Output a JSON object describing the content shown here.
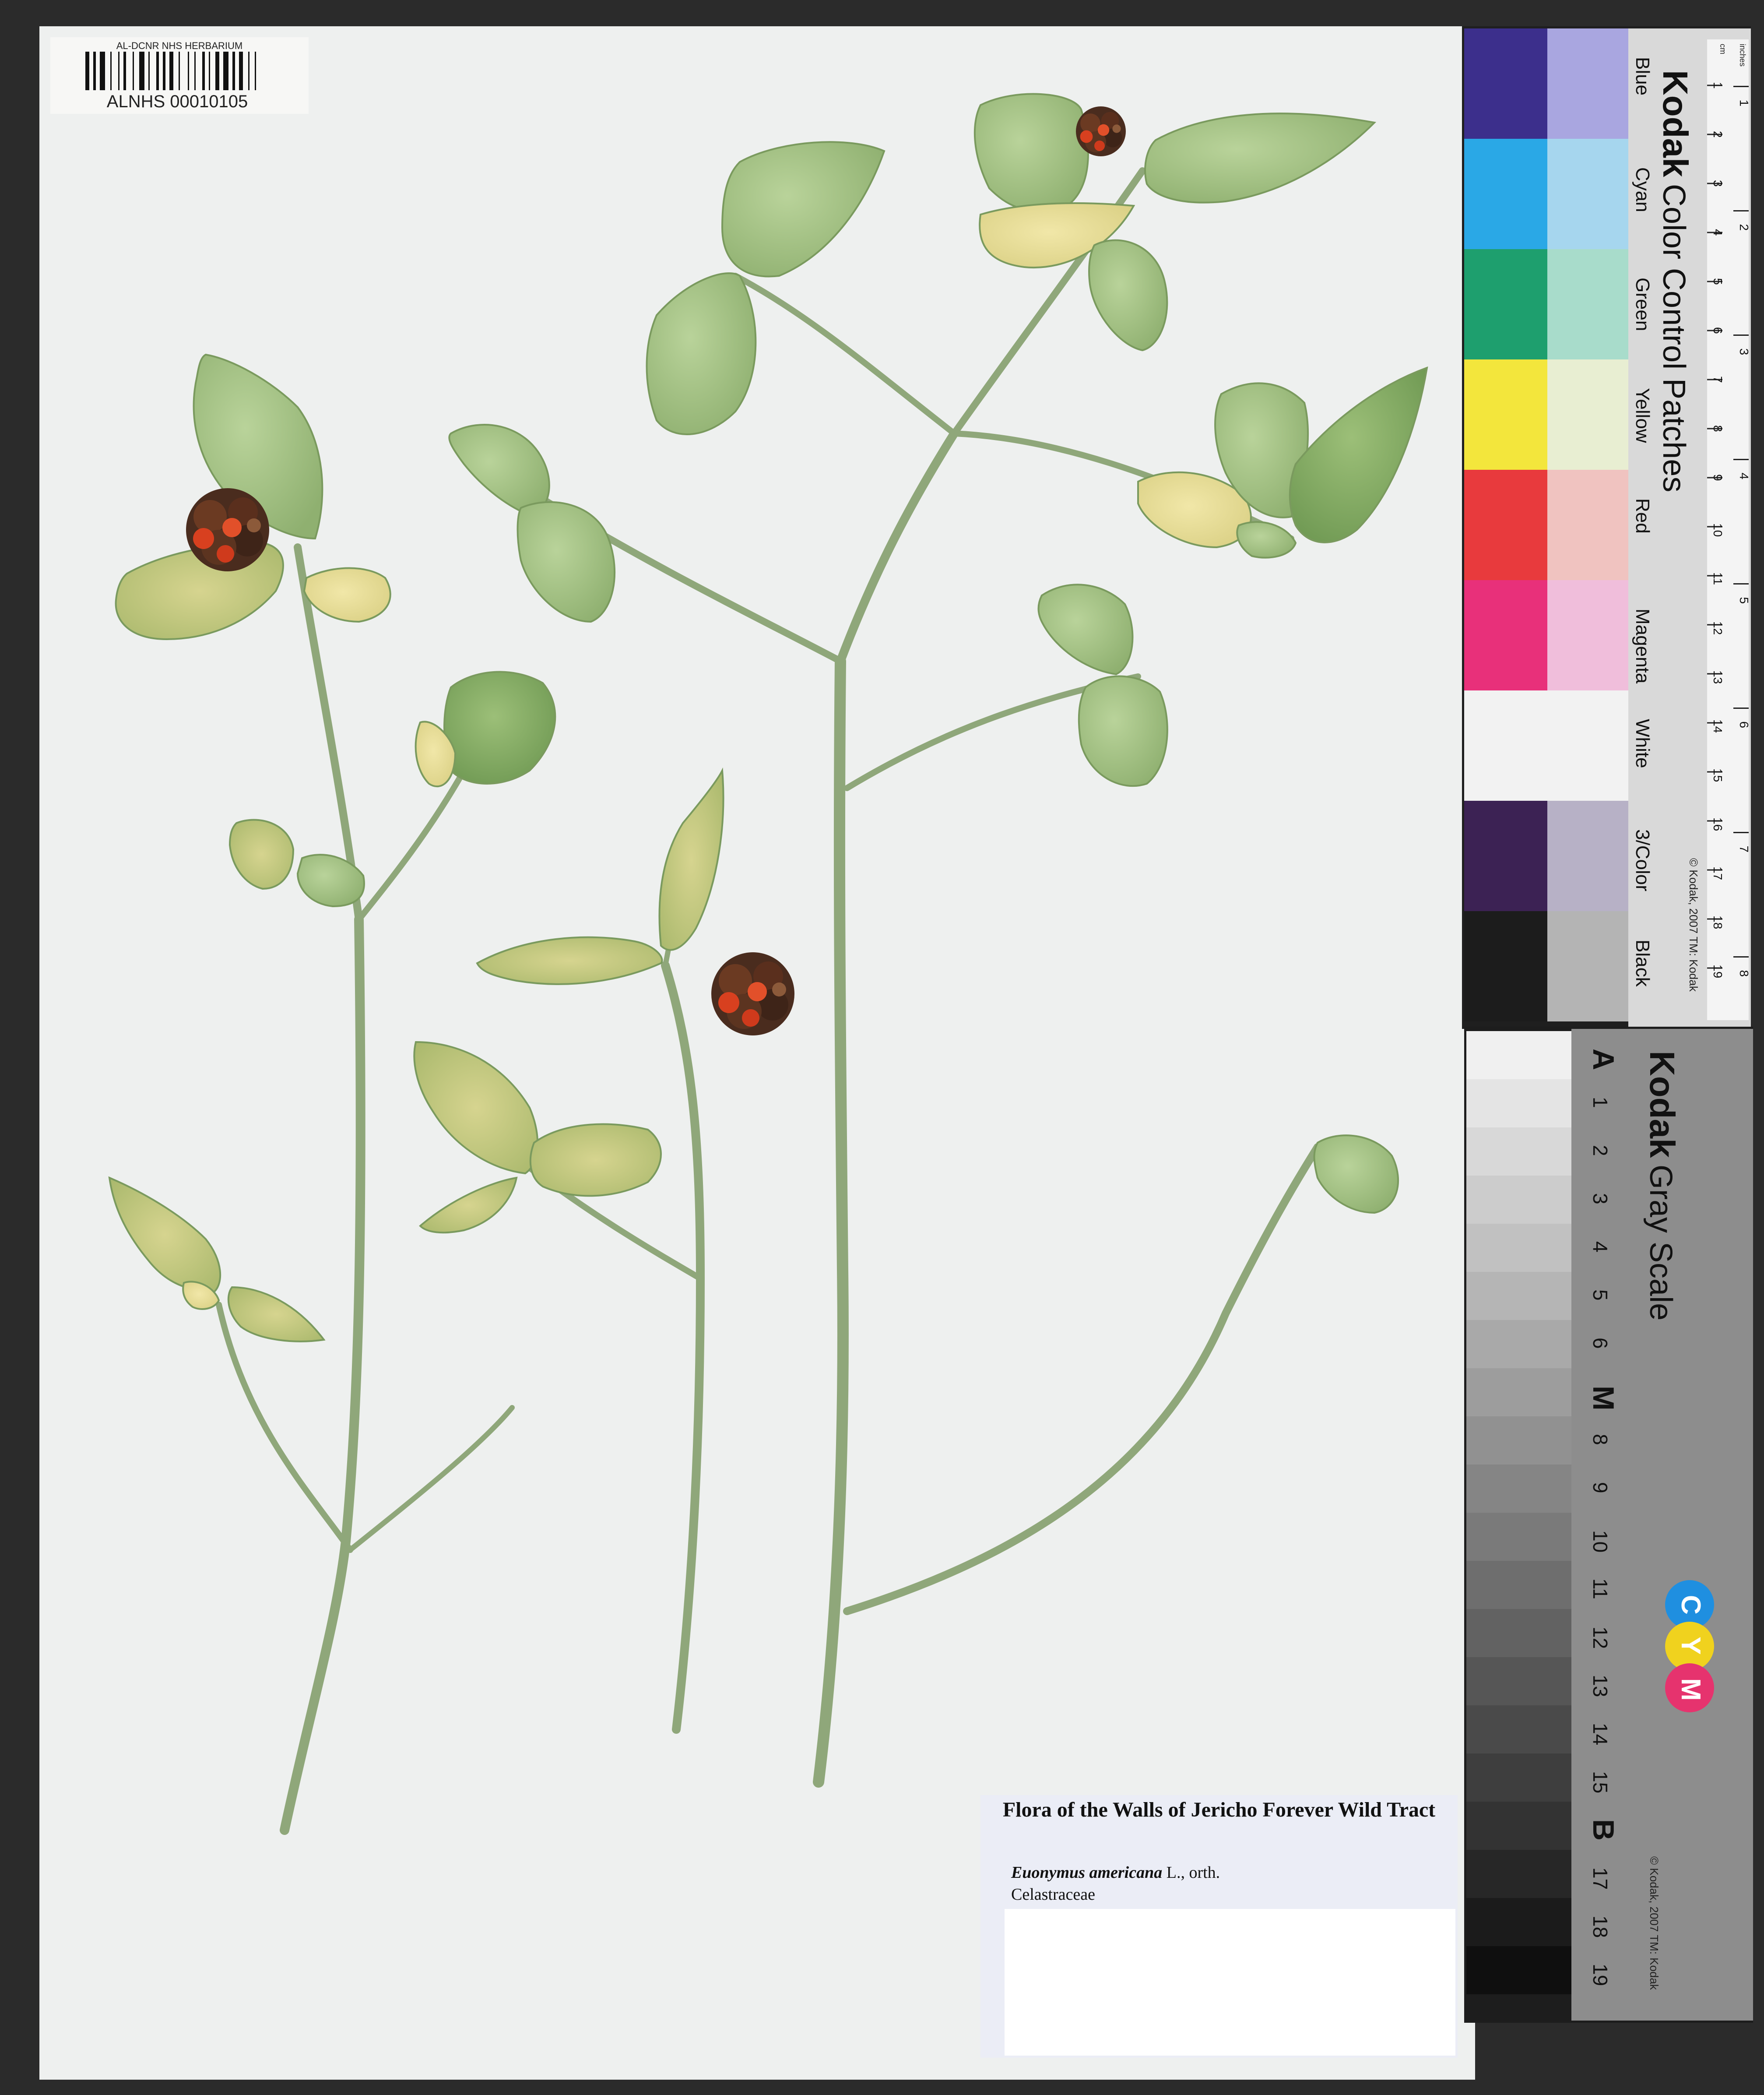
{
  "barcode": {
    "header": "AL-DCNR NHS HERBARIUM",
    "number": "ALNHS 00010105"
  },
  "label": {
    "title": "Flora of the Walls of Jericho Forever Wild Tract",
    "taxon_name": "Euonymus americana",
    "taxon_author": "L., orth.",
    "family": "Celastraceae"
  },
  "color_card": {
    "brand": "Kodak",
    "title": "Color Control Patches",
    "patches": [
      "Blue",
      "Cyan",
      "Green",
      "Yellow",
      "Red",
      "Magenta",
      "White",
      "3/Color",
      "Black"
    ],
    "colors": {
      "blue": "#3c2f8c",
      "blue_light": "#a9a6e0",
      "cyan": "#2aa8e6",
      "cyan_light": "#a6d6ee",
      "green": "#1e9f6e",
      "green_light": "#a8dccb",
      "yellow": "#f3e63c",
      "yellow_light": "#e8eed2",
      "red": "#e83a3d",
      "red_light": "#f0c3c0",
      "magenta": "#e8307a",
      "magenta_light": "#f0bedb",
      "white": "#f2f2f2",
      "tricolor": "#3c2254",
      "tricolor_light": "#b7b1c6",
      "black": "#1c1c1c",
      "black_light": "#b4b4b4"
    },
    "ruler_cm": [
      "1",
      "2",
      "3",
      "4",
      "5",
      "6",
      "7",
      "8",
      "9",
      "10",
      "11",
      "12",
      "13",
      "14",
      "15",
      "16",
      "17",
      "18",
      "19"
    ],
    "ruler_in": [
      "1",
      "2",
      "3",
      "4",
      "5",
      "6",
      "7",
      "8"
    ],
    "ruler_unit_cm": "cm",
    "ruler_unit_in": "inches",
    "copyright": "© Kodak, 2007 TM: Kodak"
  },
  "gray_card": {
    "brand": "Kodak",
    "title": "Gray Scale",
    "steps": [
      "A",
      "1",
      "2",
      "3",
      "4",
      "5",
      "6",
      "M",
      "8",
      "9",
      "10",
      "11",
      "12",
      "13",
      "14",
      "15",
      "B",
      "17",
      "18",
      "19"
    ],
    "cmy": [
      "C",
      "Y",
      "M"
    ],
    "cmy_colors": [
      "#1f8fe0",
      "#f0d21e",
      "#e6336e"
    ],
    "copyright": "© Kodak, 2007 TM: Kodak"
  }
}
